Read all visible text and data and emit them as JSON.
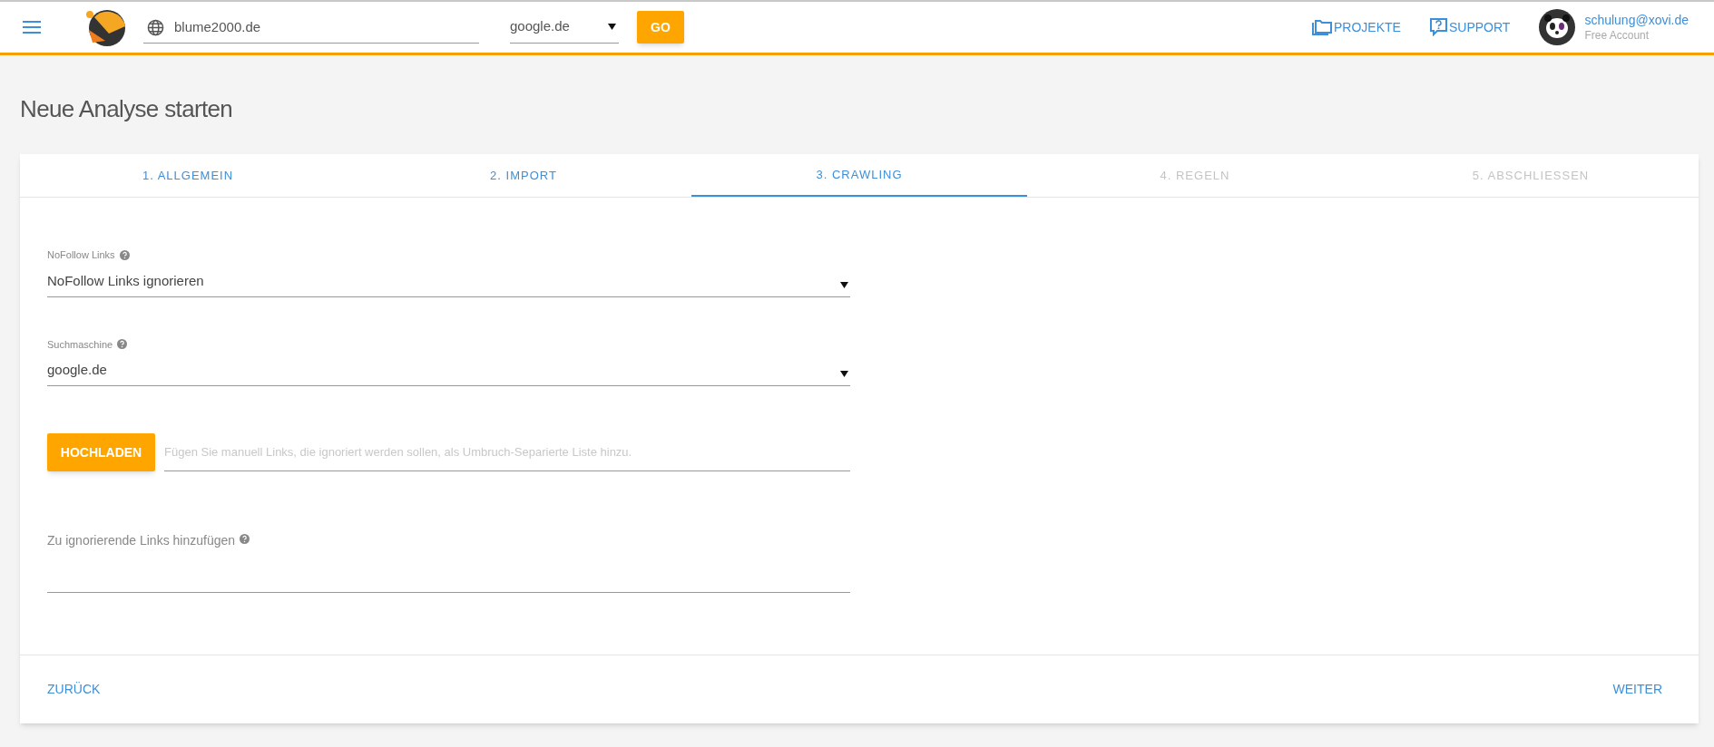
{
  "header": {
    "url_field": {
      "value": "blume2000.de"
    },
    "engine_select": {
      "value": "google.de"
    },
    "go_button": "GO",
    "nav": [
      {
        "kind": "folder",
        "label": "PROJEKTE"
      },
      {
        "kind": "help",
        "label": "SUPPORT"
      }
    ],
    "user": {
      "email": "schulung@xovi.de",
      "plan": "Free Account"
    }
  },
  "page_title": "Neue Analyse starten",
  "tabs": [
    {
      "label": "1. ALLGEMEIN",
      "selected": false,
      "disabled": false
    },
    {
      "label": "2. IMPORT",
      "selected": false,
      "disabled": false
    },
    {
      "label": "3. CRAWLING",
      "selected": true,
      "disabled": false
    },
    {
      "label": "4. REGELN",
      "selected": false,
      "disabled": true
    },
    {
      "label": "5. ABSCHLIESSEN",
      "selected": false,
      "disabled": true
    }
  ],
  "selects": [
    {
      "label": "NoFollow Links",
      "value": "NoFollow Links ignorieren"
    },
    {
      "label": "Suchmaschine",
      "value": "google.de"
    }
  ],
  "upload": {
    "button": "HOCHLADEN",
    "placeholder": "Fügen Sie manuell Links, die ignoriert werden sollen, als Umbruch-Separierte Liste hinzu."
  },
  "textarea": {
    "label": "Zu ignorierende Links hinzufügen"
  },
  "footer": {
    "back": "ZURÜCK",
    "next": "WEITER"
  }
}
